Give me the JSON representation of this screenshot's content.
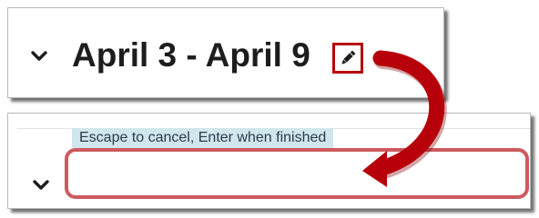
{
  "top": {
    "title": "April 3 - April 9",
    "collapse_icon": "chevron-down-icon",
    "edit_icon": "pencil-icon"
  },
  "bottom": {
    "hint": "Escape to cancel, Enter when finished",
    "input_value": "",
    "collapse_icon": "chevron-down-icon"
  },
  "annotation": {
    "highlight_color": "#b7000a",
    "arrow_color": "#b7000a",
    "input_border_color": "#cd5a5f"
  }
}
